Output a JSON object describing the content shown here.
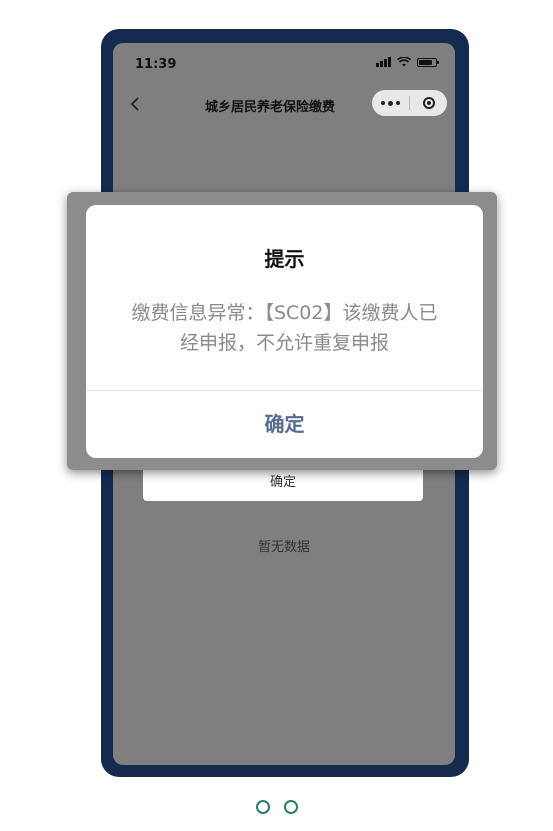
{
  "status_bar": {
    "time": "11:39"
  },
  "nav": {
    "title": "城乡居民养老保险缴费",
    "back_icon": "chevron-left-icon",
    "more_icon": "more-dots-icon",
    "close_icon": "mini-program-close-icon"
  },
  "page": {
    "button_label": "确定",
    "empty_text": "暂无数据"
  },
  "dialog": {
    "title": "提示",
    "message": "缴费信息异常：【SC02】该缴费人已经申报，不允许重复申报",
    "confirm_label": "确定",
    "confirm_color": "#576b95"
  },
  "carousel": {
    "dot_count": 2,
    "dot_color": "#2a7f62"
  },
  "colors": {
    "frame": "#142b4f",
    "overlay": "#7f7f7f"
  }
}
